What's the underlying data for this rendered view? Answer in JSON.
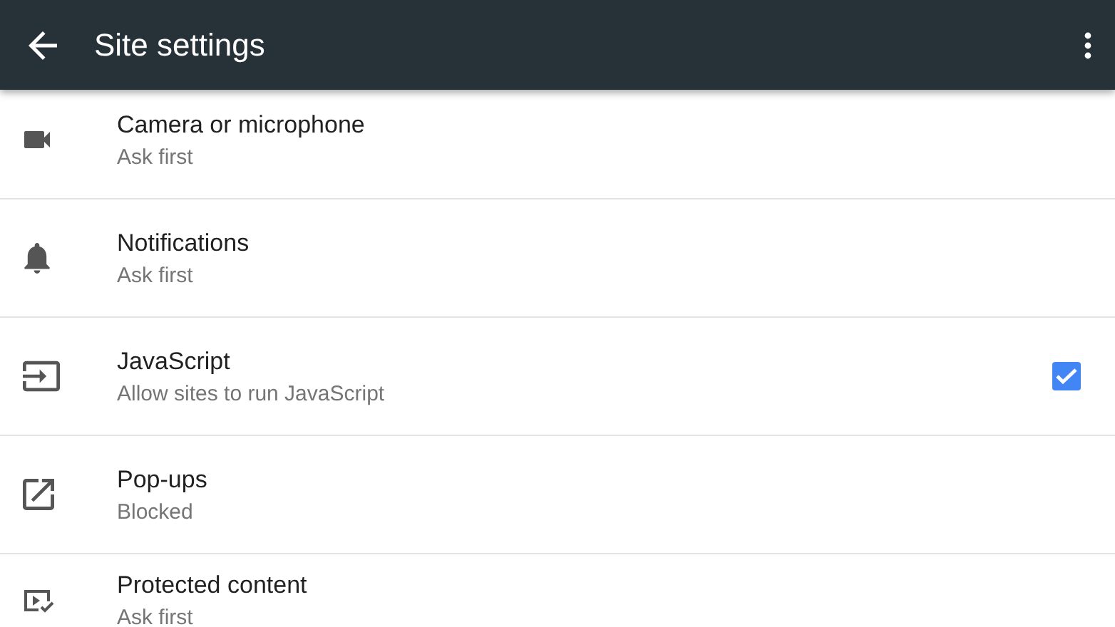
{
  "app_bar": {
    "title": "Site settings"
  },
  "settings": [
    {
      "kind": "camera",
      "title": "Camera or microphone",
      "subtitle": "Ask first"
    },
    {
      "kind": "bell",
      "title": "Notifications",
      "subtitle": "Ask first"
    },
    {
      "kind": "javascript",
      "title": "JavaScript",
      "subtitle": "Allow sites to run JavaScript",
      "checked": true
    },
    {
      "kind": "popup",
      "title": "Pop-ups",
      "subtitle": "Blocked"
    },
    {
      "kind": "protected",
      "title": "Protected content",
      "subtitle": "Ask first"
    }
  ]
}
